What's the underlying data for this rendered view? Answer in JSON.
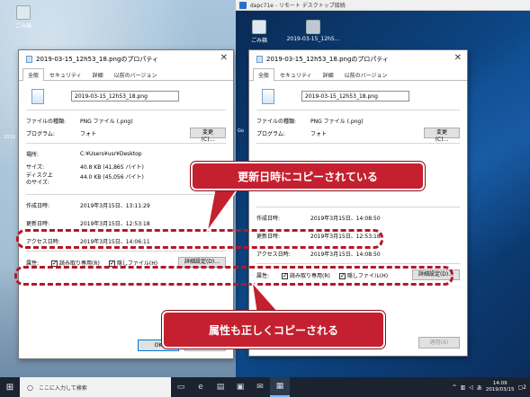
{
  "rdp": {
    "title": "dapc71e - リモート デスクトップ接続"
  },
  "desktop": {
    "recycle_bin": "ごみ箱",
    "remote_recycle_bin": "ごみ箱",
    "remote_file": "2019-03-15_12h5...",
    "side_texts": [
      "2019",
      "Go",
      "2019",
      "2019"
    ]
  },
  "left_dialog": {
    "title": "2019-03-15_12h53_18.pngのプロパティ",
    "tabs": [
      "全般",
      "セキュリティ",
      "詳細",
      "以前のバージョン"
    ],
    "filename": "2019-03-15_12h53_18.png",
    "file_type_label": "ファイルの種類:",
    "file_type": "PNG ファイル (.png)",
    "program_label": "プログラム:",
    "program": "フォト",
    "change_btn": "変更(C)...",
    "location_label": "場所:",
    "location": "C:¥Users¥usr¥Desktop",
    "size_label": "サイズ:",
    "size": "40.8 KB (41,865 バイト)",
    "disk_size_label": "ディスク上\nのサイズ:",
    "disk_size": "44.0 KB (45,056 バイト)",
    "created_label": "作成日時:",
    "created": "2019年3月15日、13:11:29",
    "modified_label": "更新日時:",
    "modified": "2019年3月15日、12:53:18",
    "accessed_label": "アクセス日時:",
    "accessed": "2019年3月15日、14:06:11",
    "attr_label": "属性:",
    "readonly": "読み取り専用(R)",
    "hidden": "隠しファイル(H)",
    "advanced_btn": "詳細設定(D)...",
    "ok_btn": "OK",
    "cancel_btn": "キャンセル"
  },
  "right_dialog": {
    "title": "2019-03-15_12h53_18.pngのプロパティ",
    "tabs": [
      "全般",
      "セキュリティ",
      "詳細",
      "以前のバージョン"
    ],
    "filename": "2019-03-15_12h53_18.png",
    "file_type_label": "ファイルの種類:",
    "file_type": "PNG ファイル (.png)",
    "program_label": "プログラム:",
    "program": "フォト",
    "change_btn": "変更(C)...",
    "created_label": "作成日時:",
    "created": "2019年3月15日、14:08:50",
    "modified_label": "更新日時:",
    "modified": "2019年3月15日、12:53:18",
    "accessed_label": "アクセス日時:",
    "accessed": "2019年3月15日、14:08:50",
    "attr_label": "属性:",
    "readonly": "読み取り専用(R)",
    "hidden": "隠しファイル(H)",
    "advanced_btn": "詳細設定(D)...",
    "apply_btn": "適用(A)"
  },
  "annotations": {
    "modified_copied": "更新日時にコピーされている",
    "attr_copied": "属性も正しくコピーされる"
  },
  "taskbar": {
    "search_placeholder": "ここに入力して検索",
    "time": "14:09",
    "date": "2019/03/15",
    "lang": "あ",
    "notif_count": "2"
  },
  "colors": {
    "accent": "#c4202f",
    "taskbar": "#1b2330"
  }
}
